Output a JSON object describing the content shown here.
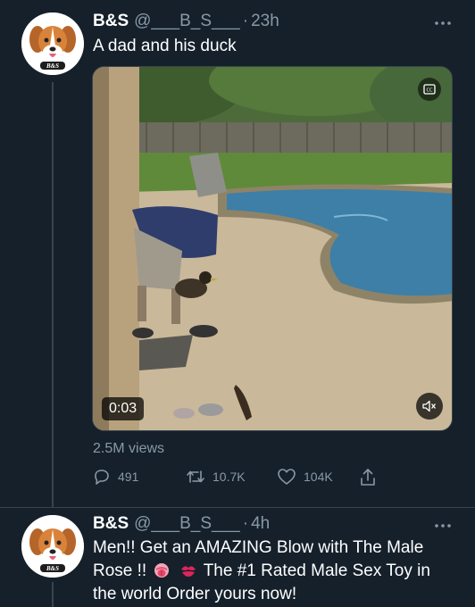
{
  "tweets": [
    {
      "author": {
        "name": "B&S",
        "handle": "@___B_S___",
        "avatar_text": "B&S"
      },
      "separator": "·",
      "time": "23h",
      "text": "A dad and his duck",
      "media": {
        "duration": "0:03",
        "has_captions_button": true,
        "muted": true
      },
      "views": "2.5M views",
      "actions": {
        "replies": "491",
        "retweets": "10.7K",
        "likes": "104K"
      }
    },
    {
      "author": {
        "name": "B&S",
        "handle": "@___B_S___",
        "avatar_text": "B&S"
      },
      "separator": "·",
      "time": "4h",
      "text_part1": "Men!! Get an AMAZING Blow with The Male",
      "text_part2": "Rose !!",
      "text_part3": "The #1 Rated Male Sex Toy in",
      "text_part4": "the world Order yours now!"
    }
  ],
  "icons": {
    "more": "more-icon",
    "reply": "reply-icon",
    "retweet": "retweet-icon",
    "like": "heart-icon",
    "share": "share-icon",
    "mute": "mute-icon",
    "captions": "captions-icon"
  },
  "colors": {
    "background": "#15202b",
    "secondary_text": "#8899a6",
    "border": "#38444d"
  }
}
